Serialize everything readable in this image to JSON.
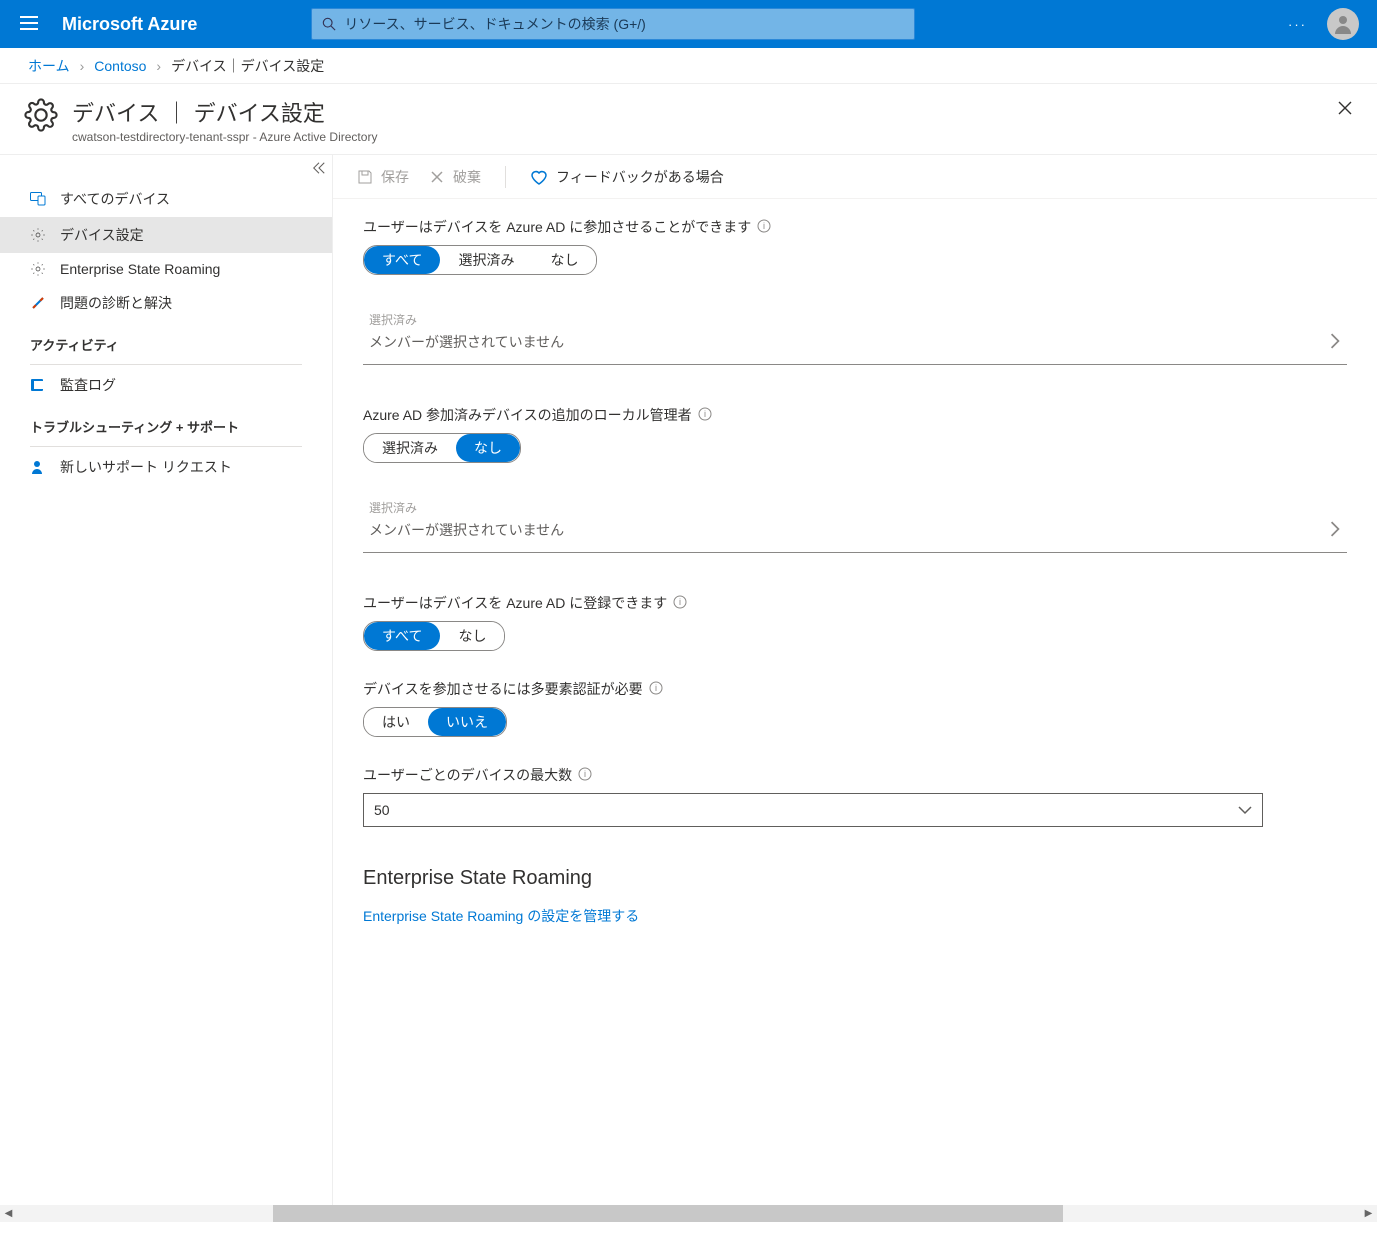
{
  "topbar": {
    "brand": "Microsoft Azure",
    "search_placeholder": "リソース、サービス、ドキュメントの検索 (G+/)",
    "more": "···"
  },
  "breadcrumb": {
    "home": "ホーム",
    "contoso": "Contoso",
    "current": "デバイス｜デバイス設定"
  },
  "title": {
    "main": "デバイス ｜ デバイス設定",
    "sub": "cwatson-testdirectory-tenant-sspr - Azure Active Directory"
  },
  "toolbar": {
    "save": "保存",
    "discard": "破棄",
    "feedback": "フィードバックがある場合"
  },
  "sidebar": {
    "items": [
      {
        "label": "すべてのデバイス"
      },
      {
        "label": "デバイス設定"
      },
      {
        "label": "Enterprise State Roaming"
      },
      {
        "label": "問題の診断と解決"
      }
    ],
    "section_activity": "アクティビティ",
    "audit_log": "監査ログ",
    "section_support": "トラブルシューティング + サポート",
    "new_request": "新しいサポート リクエスト"
  },
  "settings": {
    "join": {
      "label": "ユーザーはデバイスを Azure AD に参加させることができます",
      "options": [
        "すべて",
        "選択済み",
        "なし"
      ],
      "selected": 0,
      "member_label": "選択済み",
      "member_value": "メンバーが選択されていません"
    },
    "admins": {
      "label": "Azure AD 参加済みデバイスの追加のローカル管理者",
      "options": [
        "選択済み",
        "なし"
      ],
      "selected": 1,
      "member_label": "選択済み",
      "member_value": "メンバーが選択されていません"
    },
    "register": {
      "label": "ユーザーはデバイスを Azure AD に登録できます",
      "options": [
        "すべて",
        "なし"
      ],
      "selected": 0
    },
    "mfa": {
      "label": "デバイスを参加させるには多要素認証が必要",
      "options": [
        "はい",
        "いいえ"
      ],
      "selected": 1
    },
    "max": {
      "label": "ユーザーごとのデバイスの最大数",
      "value": "50"
    }
  },
  "esr": {
    "heading": "Enterprise State Roaming",
    "link": "Enterprise State Roaming の設定を管理する"
  }
}
